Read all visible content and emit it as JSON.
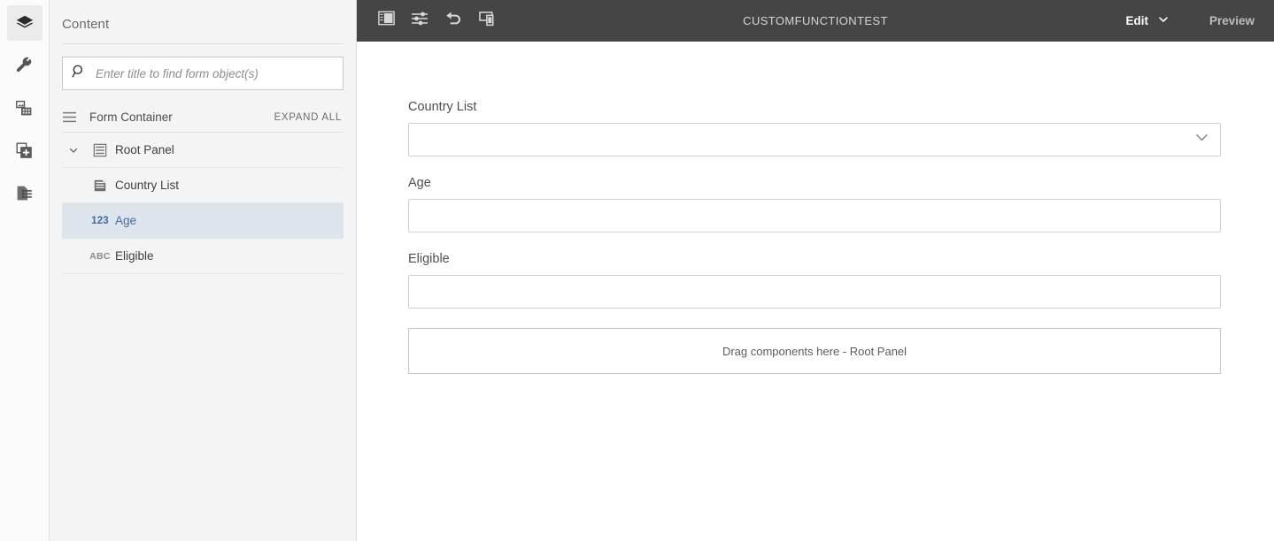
{
  "rail": {
    "items": [
      {
        "name": "layers-icon",
        "label": "Content",
        "active": true
      },
      {
        "name": "wrench-icon",
        "label": "Properties",
        "active": false
      },
      {
        "name": "assets-icon",
        "label": "Assets",
        "active": false
      },
      {
        "name": "add-component-icon",
        "label": "Components",
        "active": false
      },
      {
        "name": "content-tree-icon",
        "label": "Content Tree",
        "active": false
      }
    ]
  },
  "content_panel": {
    "title": "Content",
    "search": {
      "placeholder": "Enter title to find form object(s)",
      "value": "",
      "icon": "search-icon"
    },
    "tree_header": {
      "icon": "list-icon",
      "label": "Form Container",
      "expand_all_label": "EXPAND ALL"
    },
    "tree": [
      {
        "label": "Root Panel",
        "icon": "panel-icon",
        "indent": 0,
        "twisty": "chevron-down-icon",
        "selected": false,
        "badge": ""
      },
      {
        "label": "Country List",
        "icon": "dropdown-list-icon",
        "indent": 1,
        "twisty": "",
        "selected": false,
        "badge": ""
      },
      {
        "label": "Age",
        "icon": "number-badge",
        "indent": 1,
        "twisty": "",
        "selected": true,
        "badge": "123"
      },
      {
        "label": "Eligible",
        "icon": "text-badge",
        "indent": 1,
        "twisty": "",
        "selected": false,
        "badge": "ABC"
      }
    ]
  },
  "topbar": {
    "title": "CUSTOMFUNCTIONTEST",
    "buttons": [
      {
        "name": "toggle-sidebar-icon",
        "label": "Toggle Sidebar"
      },
      {
        "name": "sliders-icon",
        "label": "Settings"
      },
      {
        "name": "undo-icon",
        "label": "Undo"
      },
      {
        "name": "device-preview-icon",
        "label": "Emulator"
      }
    ],
    "edit_label": "Edit",
    "edit_chevron": "chevron-down-icon",
    "preview_label": "Preview"
  },
  "form": {
    "fields": [
      {
        "label": "Country List",
        "type": "select",
        "value": "",
        "chevron": "chevron-down-icon"
      },
      {
        "label": "Age",
        "type": "text",
        "value": ""
      },
      {
        "label": "Eligible",
        "type": "text",
        "value": ""
      }
    ],
    "dropzone_label": "Drag components here - Root Panel"
  },
  "colors": {
    "topbar_bg": "#454545",
    "panel_bg": "#f4f4f4",
    "selected_row_bg": "#dde4ec",
    "selected_row_text": "#4a6d9e",
    "border": "#cfcfcf"
  }
}
